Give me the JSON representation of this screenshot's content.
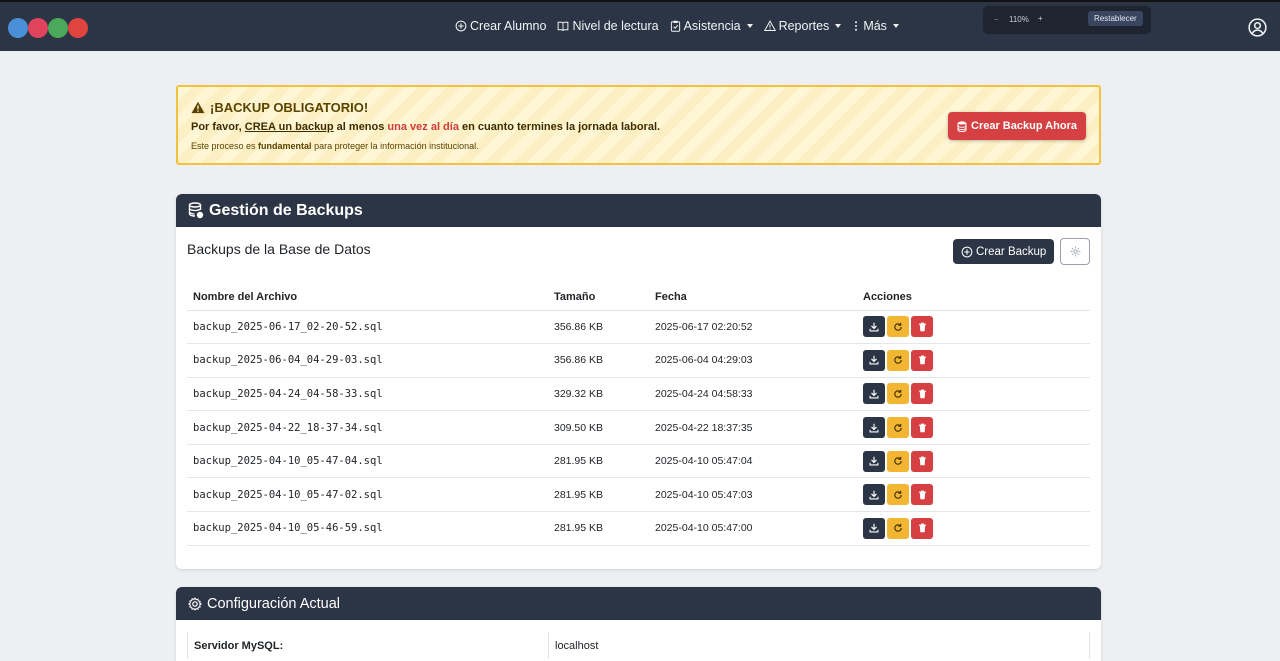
{
  "nav": {
    "items": [
      {
        "label": "Crear Alumno",
        "icon": "plus-circle-icon",
        "caret": false
      },
      {
        "label": "Nivel de lectura",
        "icon": "book-icon",
        "caret": false
      },
      {
        "label": "Asistencia",
        "icon": "clipboard-icon",
        "caret": true
      },
      {
        "label": "Reportes",
        "icon": "warning-icon",
        "caret": true
      },
      {
        "label": "Más",
        "icon": "more-vertical-icon",
        "caret": true
      }
    ],
    "zoom": {
      "minus": "−",
      "level": "110%",
      "plus": "+",
      "reset": "Restablecer"
    }
  },
  "alert": {
    "title": "¡BACKUP OBLIGATORIO!",
    "line1_pre": "Por favor, ",
    "line1_link": "CREA un backup",
    "line1_mid": " al menos ",
    "line1_red": "una vez al día",
    "line1_post": " en cuanto termines la jornada laboral.",
    "line2_pre": "Este proceso es ",
    "line2_bold": "fundamental",
    "line2_post": " para proteger la información institucional.",
    "button": "Crear Backup Ahora"
  },
  "backups": {
    "header": "Gestión de Backups",
    "subtitle": "Backups de la Base de Datos",
    "create_button": "Crear Backup",
    "columns": [
      "Nombre del Archivo",
      "Tamaño",
      "Fecha",
      "Acciones"
    ],
    "rows": [
      {
        "name": "backup_2025-06-17_02-20-52.sql",
        "size": "356.86 KB",
        "date": "2025-06-17 02:20:52"
      },
      {
        "name": "backup_2025-06-04_04-29-03.sql",
        "size": "356.86 KB",
        "date": "2025-06-04 04:29:03"
      },
      {
        "name": "backup_2025-04-24_04-58-33.sql",
        "size": "329.32 KB",
        "date": "2025-04-24 04:58:33"
      },
      {
        "name": "backup_2025-04-22_18-37-34.sql",
        "size": "309.50 KB",
        "date": "2025-04-22 18:37:35"
      },
      {
        "name": "backup_2025-04-10_05-47-04.sql",
        "size": "281.95 KB",
        "date": "2025-04-10 05:47:04"
      },
      {
        "name": "backup_2025-04-10_05-47-02.sql",
        "size": "281.95 KB",
        "date": "2025-04-10 05:47:03"
      },
      {
        "name": "backup_2025-04-10_05-46-59.sql",
        "size": "281.95 KB",
        "date": "2025-04-10 05:47:00"
      }
    ]
  },
  "config": {
    "header": "Configuración Actual",
    "rows": [
      {
        "label": "Servidor MySQL:",
        "value": "localhost"
      }
    ]
  },
  "colors": {
    "navbar": "#2c3545",
    "warning": "#f2b632",
    "danger": "#d64042"
  }
}
